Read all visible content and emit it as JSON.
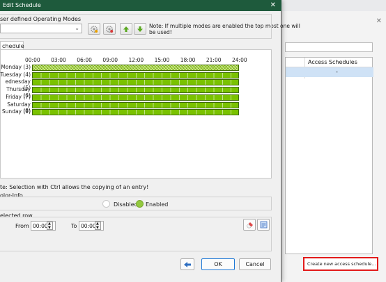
{
  "dialog": {
    "title": "Edit Schedule",
    "close_glyph": "✕",
    "operating_modes_label": "ser defined Operating Modes",
    "mode_select_value": "",
    "note_text_line1": "Note: If multiple modes are enabled the top most one will",
    "note_text_line2": "be used!",
    "tab_label": "chedule",
    "hours": [
      "00:00",
      "03:00",
      "06:00",
      "09:00",
      "12:00",
      "15:00",
      "18:00",
      "21:00",
      "24:00"
    ],
    "days": [
      {
        "label": "Monday (3)",
        "selected": true
      },
      {
        "label": "Tuesday (4)",
        "selected": false
      },
      {
        "label": "ednesday (5)",
        "selected": false
      },
      {
        "label": "Thursday (6)",
        "selected": false
      },
      {
        "label": "Friday (7)",
        "selected": false
      },
      {
        "label": "Saturday (8)",
        "selected": false
      },
      {
        "label": "Sunday (9)",
        "selected": false
      }
    ],
    "ctrl_note": "te: Selection with Ctrl allows the copying of an entry!",
    "color_info_label": "olor-Info",
    "legend_disabled": "Disabled",
    "legend_enabled": "Enabled",
    "selected_row_label": "elected row",
    "from_label": "From",
    "from_value": "00:00",
    "to_label": "To",
    "to_value": "00:00",
    "ok_label": "OK",
    "cancel_label": "Cancel",
    "colors": {
      "titlebar": "#1e5a3c",
      "enabled": "#7ac200",
      "disabled": "#ffffff"
    }
  },
  "background_window": {
    "close_glyph": "✕",
    "column_header": "Access Schedules",
    "row_value": "-",
    "create_button_label": "Create new access schedule..."
  },
  "icons": [
    "gear-add-icon",
    "gear-remove-icon",
    "arrow-up-icon",
    "arrow-down-icon",
    "eraser-icon",
    "edit-icon",
    "back-arrow-icon"
  ]
}
